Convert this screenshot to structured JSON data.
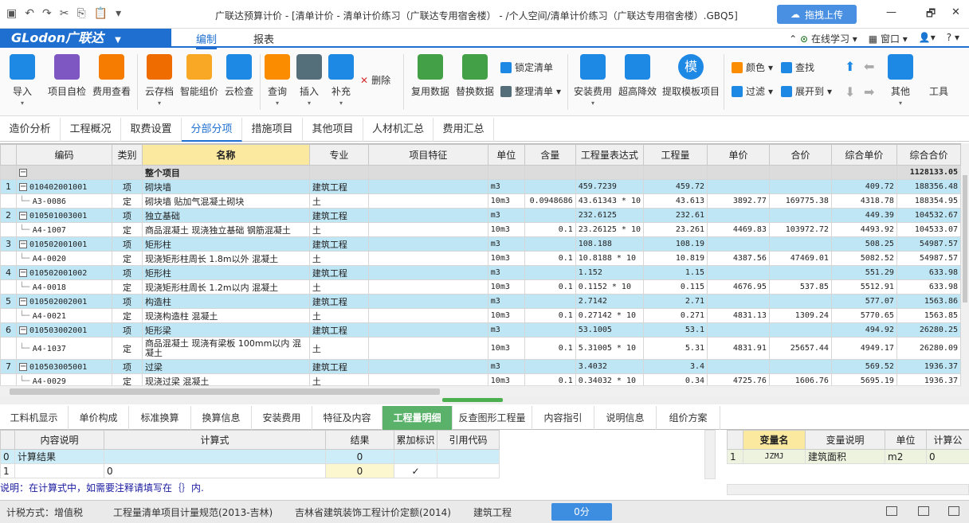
{
  "titlebar": {
    "title": "广联达预算计价 - [清单计价 - 清单计价练习（广联达专用宿舍楼） - /个人空间/清单计价练习（广联达专用宿舍楼）.GBQ5]",
    "upload": "拖拽上传",
    "min": "—",
    "max": "🗗",
    "close": "✕"
  },
  "menubar": {
    "logo": "GLodon广联达",
    "tabs": [
      "编制",
      "报表"
    ],
    "online": "在线学习",
    "window": "窗口",
    "help": "?"
  },
  "ribbon": {
    "buttons": [
      {
        "label": "导入",
        "color": "#1e88e5"
      },
      {
        "label": "项目自检",
        "color": "#7e57c2"
      },
      {
        "label": "费用查看",
        "color": "#f57c00"
      },
      {
        "label": "云存档",
        "color": "#ef6c00"
      },
      {
        "label": "智能组价",
        "color": "#f9a825"
      },
      {
        "label": "云检查",
        "color": "#1e88e5"
      },
      {
        "label": "查询",
        "color": "#fb8c00"
      },
      {
        "label": "插入",
        "color": "#546e7a"
      },
      {
        "label": "补充",
        "color": "#1e88e5"
      },
      {
        "label": "复用数据",
        "color": "#43a047"
      },
      {
        "label": "替换数据",
        "color": "#43a047"
      },
      {
        "label": "安装费用",
        "color": "#1e88e5"
      },
      {
        "label": "超高降效",
        "color": "#1e88e5"
      },
      {
        "label": "提取模板项目",
        "color": "#1e88e5"
      },
      {
        "label": "其他",
        "color": "#1e88e5"
      },
      {
        "label": "工具",
        "color": "#fafafa"
      }
    ],
    "delete": "删除",
    "lock": "锁定清单",
    "organize": "整理清单",
    "color": "颜色",
    "find": "查找",
    "filter": "过滤",
    "expand": "展开到",
    "template_char": "模"
  },
  "tabs1": [
    "造价分析",
    "工程概况",
    "取费设置",
    "分部分项",
    "措施项目",
    "其他项目",
    "人材机汇总",
    "费用汇总"
  ],
  "grid": {
    "headers": [
      "编码",
      "类别",
      "名称",
      "专业",
      "项目特征",
      "单位",
      "含量",
      "工程量表达式",
      "工程量",
      "单价",
      "合价",
      "综合单价",
      "综合合价"
    ],
    "rows": [
      {
        "type": "whole",
        "no": "",
        "code": "",
        "cat": "",
        "name": "整个项目",
        "spec": "",
        "feat": "",
        "unit": "",
        "qty": "",
        "expr": "",
        "amount": "",
        "price": "",
        "total": "",
        "uprice": "",
        "utotal": "1128133.05"
      },
      {
        "type": "xm",
        "no": "1",
        "code": "010402001001",
        "cat": "项",
        "name": "砌块墙",
        "spec": "建筑工程",
        "feat": "",
        "unit": "m3",
        "qty": "",
        "expr": "459.7239",
        "amount": "459.72",
        "price": "",
        "total": "",
        "uprice": "409.72",
        "utotal": "188356.48"
      },
      {
        "type": "de",
        "no": "",
        "code": "A3-0086",
        "cat": "定",
        "name": "砌块墙 贴加气混凝土砌块",
        "spec": "土",
        "feat": "",
        "unit": "10m3",
        "qty": "0.0948686",
        "expr": "43.61343 * 10",
        "amount": "43.613",
        "price": "3892.77",
        "total": "169775.38",
        "uprice": "4318.78",
        "utotal": "188354.95"
      },
      {
        "type": "xm",
        "no": "2",
        "code": "010501003001",
        "cat": "项",
        "name": "独立基础",
        "spec": "建筑工程",
        "feat": "",
        "unit": "m3",
        "qty": "",
        "expr": "232.6125",
        "amount": "232.61",
        "price": "",
        "total": "",
        "uprice": "449.39",
        "utotal": "104532.67"
      },
      {
        "type": "de",
        "no": "",
        "code": "A4-1007",
        "cat": "定",
        "name": "商品混凝土 现浇独立基础 钢筋混凝土",
        "spec": "土",
        "feat": "",
        "unit": "10m3",
        "qty": "0.1",
        "expr": "23.26125 * 10",
        "amount": "23.261",
        "price": "4469.83",
        "total": "103972.72",
        "uprice": "4493.92",
        "utotal": "104533.07"
      },
      {
        "type": "xm",
        "no": "3",
        "code": "010502001001",
        "cat": "项",
        "name": "矩形柱",
        "spec": "建筑工程",
        "feat": "",
        "unit": "m3",
        "qty": "",
        "expr": "108.188",
        "amount": "108.19",
        "price": "",
        "total": "",
        "uprice": "508.25",
        "utotal": "54987.57"
      },
      {
        "type": "de",
        "no": "",
        "code": "A4-0020",
        "cat": "定",
        "name": "现浇矩形柱周长 1.8m以外 混凝土",
        "spec": "土",
        "feat": "",
        "unit": "10m3",
        "qty": "0.1",
        "expr": "10.8188 * 10",
        "amount": "10.819",
        "price": "4387.56",
        "total": "47469.01",
        "uprice": "5082.52",
        "utotal": "54987.57"
      },
      {
        "type": "xm",
        "no": "4",
        "code": "010502001002",
        "cat": "项",
        "name": "矩形柱",
        "spec": "建筑工程",
        "feat": "",
        "unit": "m3",
        "qty": "",
        "expr": "1.152",
        "amount": "1.15",
        "price": "",
        "total": "",
        "uprice": "551.29",
        "utotal": "633.98"
      },
      {
        "type": "de",
        "no": "",
        "code": "A4-0018",
        "cat": "定",
        "name": "现浇矩形柱周长 1.2m以内 混凝土",
        "spec": "土",
        "feat": "",
        "unit": "10m3",
        "qty": "0.1",
        "expr": "0.1152 * 10",
        "amount": "0.115",
        "price": "4676.95",
        "total": "537.85",
        "uprice": "5512.91",
        "utotal": "633.98"
      },
      {
        "type": "xm",
        "no": "5",
        "code": "010502002001",
        "cat": "项",
        "name": "构造柱",
        "spec": "建筑工程",
        "feat": "",
        "unit": "m3",
        "qty": "",
        "expr": "2.7142",
        "amount": "2.71",
        "price": "",
        "total": "",
        "uprice": "577.07",
        "utotal": "1563.86"
      },
      {
        "type": "de",
        "no": "",
        "code": "A4-0021",
        "cat": "定",
        "name": "现浇构造柱 混凝土",
        "spec": "土",
        "feat": "",
        "unit": "10m3",
        "qty": "0.1",
        "expr": "0.27142 * 10",
        "amount": "0.271",
        "price": "4831.13",
        "total": "1309.24",
        "uprice": "5770.65",
        "utotal": "1563.85"
      },
      {
        "type": "xm",
        "no": "6",
        "code": "010503002001",
        "cat": "项",
        "name": "矩形梁",
        "spec": "建筑工程",
        "feat": "",
        "unit": "m3",
        "qty": "",
        "expr": "53.1005",
        "amount": "53.1",
        "price": "",
        "total": "",
        "uprice": "494.92",
        "utotal": "26280.25"
      },
      {
        "type": "de2",
        "no": "",
        "code": "A4-1037",
        "cat": "定",
        "name": "商品混凝土 现浇有梁板 100mm以内 混凝土",
        "spec": "土",
        "feat": "",
        "unit": "10m3",
        "qty": "0.1",
        "expr": "5.31005 * 10",
        "amount": "5.31",
        "price": "4831.91",
        "total": "25657.44",
        "uprice": "4949.17",
        "utotal": "26280.09"
      },
      {
        "type": "xm",
        "no": "7",
        "code": "010503005001",
        "cat": "项",
        "name": "过梁",
        "spec": "建筑工程",
        "feat": "",
        "unit": "m3",
        "qty": "",
        "expr": "3.4032",
        "amount": "3.4",
        "price": "",
        "total": "",
        "uprice": "569.52",
        "utotal": "1936.37"
      },
      {
        "type": "de",
        "no": "",
        "code": "A4-0029",
        "cat": "定",
        "name": "现浇过梁 混凝土",
        "spec": "土",
        "feat": "",
        "unit": "10m3",
        "qty": "0.1",
        "expr": "0.34032 * 10",
        "amount": "0.34",
        "price": "4725.76",
        "total": "1606.76",
        "uprice": "5695.19",
        "utotal": "1936.37"
      }
    ]
  },
  "tabs2": [
    "工料机显示",
    "单价构成",
    "标准换算",
    "换算信息",
    "安装费用",
    "特征及内容",
    "工程量明细",
    "反查图形工程量",
    "内容指引",
    "说明信息",
    "组价方案"
  ],
  "sub": {
    "headers": [
      "内容说明",
      "计算式",
      "结果",
      "累加标识",
      "引用代码"
    ],
    "rows": [
      {
        "no": "0",
        "desc": "计算结果",
        "formula": "",
        "result": "0",
        "acc": "",
        "ref": ""
      },
      {
        "no": "1",
        "desc": "",
        "formula": "0",
        "result": "0",
        "acc": "✓",
        "ref": ""
      }
    ]
  },
  "right": {
    "headers": [
      "变量名",
      "变量说明",
      "单位",
      "计算公"
    ],
    "rows": [
      {
        "no": "1",
        "name": "JZMJ",
        "desc": "建筑面积",
        "unit": "m2",
        "formula": "0"
      }
    ]
  },
  "note": "说明：在计算式中，如需要注释请填写在｛｝内.",
  "status": {
    "tax": "计税方式：增值税",
    "spec": "工程量清单项目计量规范(2013-吉林)",
    "quota": "吉林省建筑装饰工程计价定额(2014)",
    "major": "建筑工程",
    "score": "0分"
  }
}
